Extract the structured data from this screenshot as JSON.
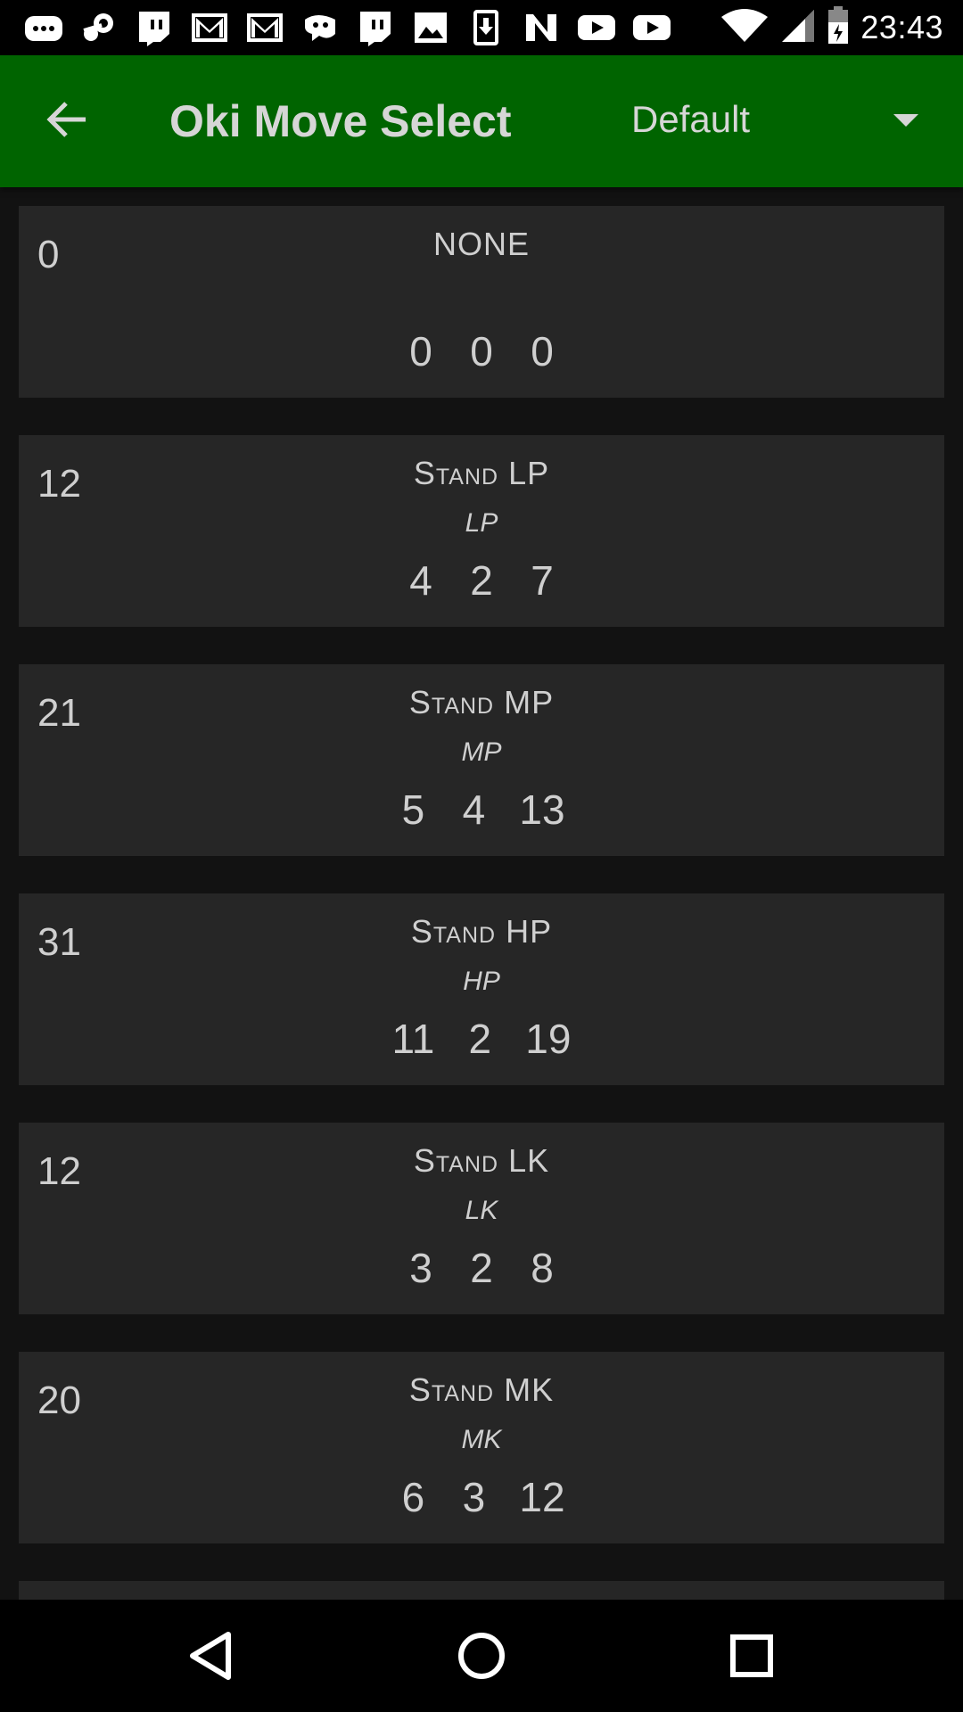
{
  "status_bar": {
    "time": "23:43",
    "notification_icons": [
      "chat-icon",
      "steam-icon",
      "twitch-icon",
      "gmail-icon",
      "gmail-icon",
      "discord-icon",
      "twitch-icon",
      "image-icon",
      "download-icon",
      "n-app-icon",
      "youtube-icon",
      "youtube-icon"
    ]
  },
  "app_bar": {
    "title": "Oki Move Select",
    "preset": "Default",
    "color": "#006400"
  },
  "moves": [
    {
      "cost": "0",
      "name": "NONE",
      "input": "",
      "startup": "0",
      "active": "0",
      "recovery": "0"
    },
    {
      "cost": "12",
      "name": "Stand LP",
      "input": "LP",
      "startup": "4",
      "active": "2",
      "recovery": "7"
    },
    {
      "cost": "21",
      "name": "Stand MP",
      "input": "MP",
      "startup": "5",
      "active": "4",
      "recovery": "13"
    },
    {
      "cost": "31",
      "name": "Stand HP",
      "input": "HP",
      "startup": "11",
      "active": "2",
      "recovery": "19"
    },
    {
      "cost": "12",
      "name": "Stand LK",
      "input": "LK",
      "startup": "3",
      "active": "2",
      "recovery": "8"
    },
    {
      "cost": "20",
      "name": "Stand MK",
      "input": "MK",
      "startup": "6",
      "active": "3",
      "recovery": "12"
    }
  ]
}
